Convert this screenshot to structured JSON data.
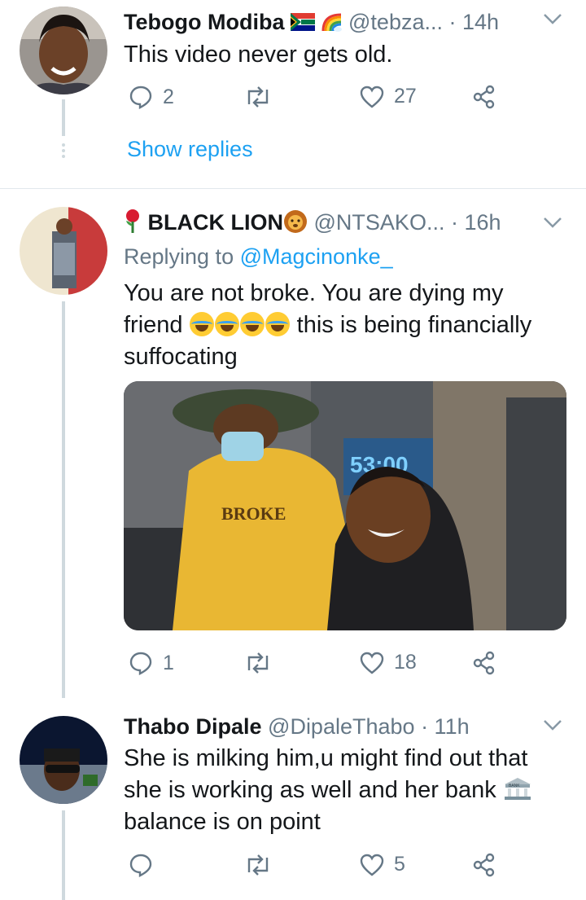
{
  "tweets": [
    {
      "name": "Tebogo Modiba",
      "handle": "@tebza...",
      "time": "· 14h",
      "text": "This video never gets old.",
      "replies": "2",
      "likes": "27",
      "show_replies": "Show replies"
    },
    {
      "name": "BLACK LION",
      "handle": "@NTSAKO...",
      "time": "· 16h",
      "replying_prefix": "Replying to",
      "replying_to": "@Magcinonke_",
      "text_line1": "You are not broke. You are dying my",
      "text_line2": "friend",
      "text_line2_rest": " this is being financially",
      "text_line3": "suffocating",
      "media": {
        "shirt_text": "BROKE",
        "screen_text": "53:00"
      },
      "replies": "1",
      "likes": "18"
    },
    {
      "name": "Thabo Dipale",
      "handle": "@DipaleThabo",
      "time": "· 11h",
      "text_line1": "She is milking him,u might find out that",
      "text_line2": "she is working as well and her bank",
      "text_line3": "balance is on point",
      "bank_sign": "BANK",
      "replies": "",
      "likes": "5"
    }
  ],
  "colors": {
    "accent": "#1da1f2",
    "secondary_text": "#657786",
    "thread_line": "#cfd9de"
  }
}
